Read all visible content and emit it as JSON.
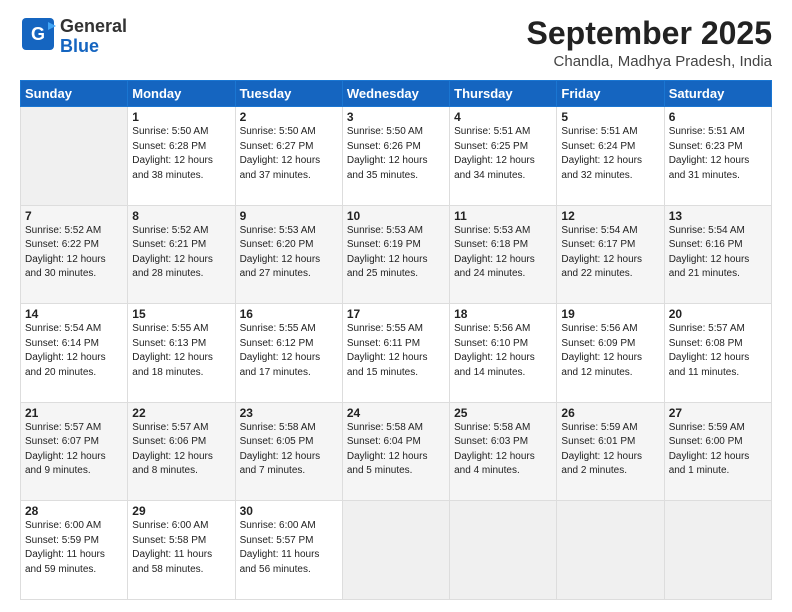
{
  "logo": {
    "general": "General",
    "blue": "Blue"
  },
  "header": {
    "month": "September 2025",
    "location": "Chandla, Madhya Pradesh, India"
  },
  "days_header": [
    "Sunday",
    "Monday",
    "Tuesday",
    "Wednesday",
    "Thursday",
    "Friday",
    "Saturday"
  ],
  "weeks": [
    [
      {
        "day": "",
        "info": ""
      },
      {
        "day": "1",
        "info": "Sunrise: 5:50 AM\nSunset: 6:28 PM\nDaylight: 12 hours\nand 38 minutes."
      },
      {
        "day": "2",
        "info": "Sunrise: 5:50 AM\nSunset: 6:27 PM\nDaylight: 12 hours\nand 37 minutes."
      },
      {
        "day": "3",
        "info": "Sunrise: 5:50 AM\nSunset: 6:26 PM\nDaylight: 12 hours\nand 35 minutes."
      },
      {
        "day": "4",
        "info": "Sunrise: 5:51 AM\nSunset: 6:25 PM\nDaylight: 12 hours\nand 34 minutes."
      },
      {
        "day": "5",
        "info": "Sunrise: 5:51 AM\nSunset: 6:24 PM\nDaylight: 12 hours\nand 32 minutes."
      },
      {
        "day": "6",
        "info": "Sunrise: 5:51 AM\nSunset: 6:23 PM\nDaylight: 12 hours\nand 31 minutes."
      }
    ],
    [
      {
        "day": "7",
        "info": "Sunrise: 5:52 AM\nSunset: 6:22 PM\nDaylight: 12 hours\nand 30 minutes."
      },
      {
        "day": "8",
        "info": "Sunrise: 5:52 AM\nSunset: 6:21 PM\nDaylight: 12 hours\nand 28 minutes."
      },
      {
        "day": "9",
        "info": "Sunrise: 5:53 AM\nSunset: 6:20 PM\nDaylight: 12 hours\nand 27 minutes."
      },
      {
        "day": "10",
        "info": "Sunrise: 5:53 AM\nSunset: 6:19 PM\nDaylight: 12 hours\nand 25 minutes."
      },
      {
        "day": "11",
        "info": "Sunrise: 5:53 AM\nSunset: 6:18 PM\nDaylight: 12 hours\nand 24 minutes."
      },
      {
        "day": "12",
        "info": "Sunrise: 5:54 AM\nSunset: 6:17 PM\nDaylight: 12 hours\nand 22 minutes."
      },
      {
        "day": "13",
        "info": "Sunrise: 5:54 AM\nSunset: 6:16 PM\nDaylight: 12 hours\nand 21 minutes."
      }
    ],
    [
      {
        "day": "14",
        "info": "Sunrise: 5:54 AM\nSunset: 6:14 PM\nDaylight: 12 hours\nand 20 minutes."
      },
      {
        "day": "15",
        "info": "Sunrise: 5:55 AM\nSunset: 6:13 PM\nDaylight: 12 hours\nand 18 minutes."
      },
      {
        "day": "16",
        "info": "Sunrise: 5:55 AM\nSunset: 6:12 PM\nDaylight: 12 hours\nand 17 minutes."
      },
      {
        "day": "17",
        "info": "Sunrise: 5:55 AM\nSunset: 6:11 PM\nDaylight: 12 hours\nand 15 minutes."
      },
      {
        "day": "18",
        "info": "Sunrise: 5:56 AM\nSunset: 6:10 PM\nDaylight: 12 hours\nand 14 minutes."
      },
      {
        "day": "19",
        "info": "Sunrise: 5:56 AM\nSunset: 6:09 PM\nDaylight: 12 hours\nand 12 minutes."
      },
      {
        "day": "20",
        "info": "Sunrise: 5:57 AM\nSunset: 6:08 PM\nDaylight: 12 hours\nand 11 minutes."
      }
    ],
    [
      {
        "day": "21",
        "info": "Sunrise: 5:57 AM\nSunset: 6:07 PM\nDaylight: 12 hours\nand 9 minutes."
      },
      {
        "day": "22",
        "info": "Sunrise: 5:57 AM\nSunset: 6:06 PM\nDaylight: 12 hours\nand 8 minutes."
      },
      {
        "day": "23",
        "info": "Sunrise: 5:58 AM\nSunset: 6:05 PM\nDaylight: 12 hours\nand 7 minutes."
      },
      {
        "day": "24",
        "info": "Sunrise: 5:58 AM\nSunset: 6:04 PM\nDaylight: 12 hours\nand 5 minutes."
      },
      {
        "day": "25",
        "info": "Sunrise: 5:58 AM\nSunset: 6:03 PM\nDaylight: 12 hours\nand 4 minutes."
      },
      {
        "day": "26",
        "info": "Sunrise: 5:59 AM\nSunset: 6:01 PM\nDaylight: 12 hours\nand 2 minutes."
      },
      {
        "day": "27",
        "info": "Sunrise: 5:59 AM\nSunset: 6:00 PM\nDaylight: 12 hours\nand 1 minute."
      }
    ],
    [
      {
        "day": "28",
        "info": "Sunrise: 6:00 AM\nSunset: 5:59 PM\nDaylight: 11 hours\nand 59 minutes."
      },
      {
        "day": "29",
        "info": "Sunrise: 6:00 AM\nSunset: 5:58 PM\nDaylight: 11 hours\nand 58 minutes."
      },
      {
        "day": "30",
        "info": "Sunrise: 6:00 AM\nSunset: 5:57 PM\nDaylight: 11 hours\nand 56 minutes."
      },
      {
        "day": "",
        "info": ""
      },
      {
        "day": "",
        "info": ""
      },
      {
        "day": "",
        "info": ""
      },
      {
        "day": "",
        "info": ""
      }
    ]
  ]
}
